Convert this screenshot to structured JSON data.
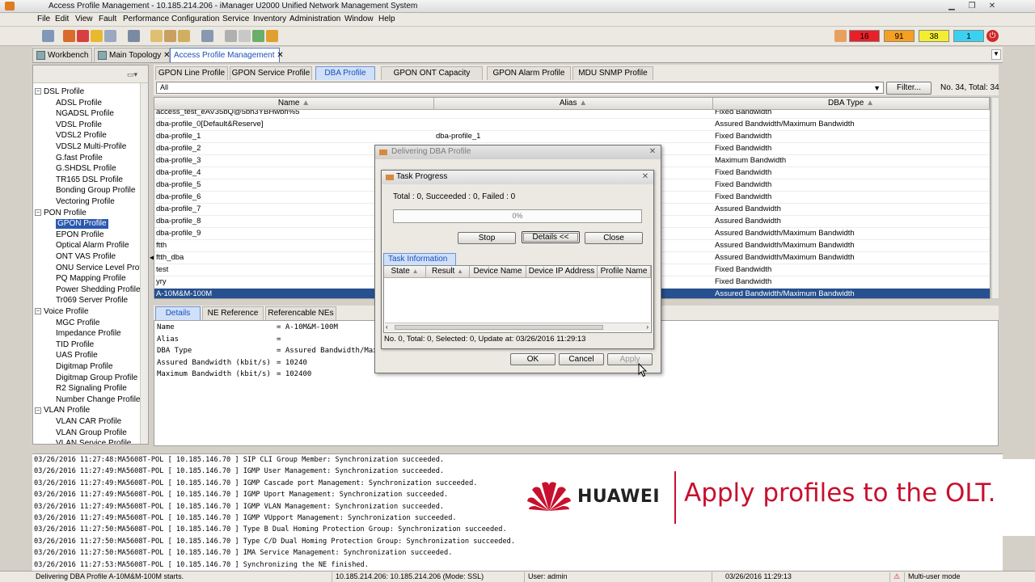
{
  "window": {
    "title": "Access Profile Management - 10.185.214.206 - iManager U2000 Unified Network Management System"
  },
  "menu": [
    "File",
    "Edit",
    "View",
    "Fault",
    "Performance",
    "Configuration",
    "Service",
    "Inventory",
    "Administration",
    "Window",
    "Help"
  ],
  "alarms": [
    {
      "count": "16",
      "color": "#e8202a"
    },
    {
      "count": "91",
      "color": "#f5a020"
    },
    {
      "count": "38",
      "color": "#f4ee30"
    },
    {
      "count": "1",
      "color": "#3ad2f0"
    }
  ],
  "window_tabs": [
    "Workbench",
    "Main Topology",
    "Access Profile Management"
  ],
  "tree": {
    "groups": [
      {
        "label": "DSL Profile",
        "children": [
          "ADSL Profile",
          "NGADSL Profile",
          "VDSL Profile",
          "VDSL2 Profile",
          "VDSL2 Multi-Profile",
          "G.fast Profile",
          "G.SHDSL Profile",
          "TR165 DSL Profile",
          "Bonding Group Profile",
          "Vectoring Profile"
        ]
      },
      {
        "label": "PON Profile",
        "children": [
          "GPON Profile",
          "EPON Profile",
          "Optical Alarm Profile",
          "ONT VAS Profile",
          "ONU Service Level Profile",
          "PQ Mapping Profile",
          "Power Shedding Profile",
          "Tr069 Server Profile"
        ]
      },
      {
        "label": "Voice Profile",
        "children": [
          "MGC Profile",
          "Impedance Profile",
          "TID Profile",
          "UAS Profile",
          "Digitmap Profile",
          "Digitmap Group Profile",
          "R2 Signaling Profile",
          "Number Change Profile"
        ]
      },
      {
        "label": "VLAN Profile",
        "children": [
          "VLAN CAR Profile",
          "VLAN Group Profile",
          "VLAN Service Profile"
        ]
      }
    ],
    "selected": "GPON Profile"
  },
  "profile_tabs": [
    "GPON Line Profile",
    "GPON Service Profile",
    "DBA Profile",
    "GPON ONT Capacity Profile",
    "GPON Alarm Profile",
    "MDU SNMP Profile"
  ],
  "filter": {
    "value": "All",
    "button": "Filter...",
    "count": "No. 34, Total: 34"
  },
  "grid": {
    "columns": [
      "Name",
      "Alias",
      "DBA Type"
    ],
    "rows": [
      {
        "name": "access_test_eAV35bQ@5bh3YBHwbh%5",
        "alias": "",
        "type": "Fixed Bandwidth"
      },
      {
        "name": "dba-profile_0[Default&Reserve]",
        "alias": "",
        "type": "Assured Bandwidth/Maximum Bandwidth"
      },
      {
        "name": "dba-profile_1",
        "alias": "dba-profile_1",
        "type": "Fixed Bandwidth"
      },
      {
        "name": "dba-profile_2",
        "alias": "",
        "type": "Fixed Bandwidth"
      },
      {
        "name": "dba-profile_3",
        "alias": "",
        "type": "Maximum Bandwidth"
      },
      {
        "name": "dba-profile_4",
        "alias": "",
        "type": "Fixed Bandwidth"
      },
      {
        "name": "dba-profile_5",
        "alias": "",
        "type": "Fixed Bandwidth"
      },
      {
        "name": "dba-profile_6",
        "alias": "",
        "type": "Fixed Bandwidth"
      },
      {
        "name": "dba-profile_7",
        "alias": "",
        "type": "Assured Bandwidth"
      },
      {
        "name": "dba-profile_8",
        "alias": "",
        "type": "Assured Bandwidth"
      },
      {
        "name": "dba-profile_9",
        "alias": "",
        "type": "Assured Bandwidth/Maximum Bandwidth"
      },
      {
        "name": "ftth",
        "alias": "",
        "type": "Assured Bandwidth/Maximum Bandwidth"
      },
      {
        "name": "ftth_dba",
        "alias": "",
        "type": "Assured Bandwidth/Maximum Bandwidth"
      },
      {
        "name": "test",
        "alias": "",
        "type": "Fixed Bandwidth"
      },
      {
        "name": "yry",
        "alias": "",
        "type": "Fixed Bandwidth"
      },
      {
        "name": "A-10M&M-100M",
        "alias": "",
        "type": "Assured Bandwidth/Maximum Bandwidth"
      }
    ],
    "selected_index": 15
  },
  "detail_tabs": [
    "Details",
    "NE Reference",
    "Referencable NEs"
  ],
  "details": [
    {
      "key": "Name",
      "value": "= A-10M&M-100M"
    },
    {
      "key": "Alias",
      "value": "="
    },
    {
      "key": "DBA Type",
      "value": "= Assured Bandwidth/Maximum Bandwidth"
    },
    {
      "key": "Assured Bandwidth (kbit/s)",
      "value": "= 10240"
    },
    {
      "key": "Maximum Bandwidth (kbit/s)",
      "value": "= 102400"
    }
  ],
  "log": [
    "03/26/2016 11:27:48:MA5608T-POL [ 10.185.146.70 ] SIP CLI Group Member: Synchronization succeeded.",
    "03/26/2016 11:27:49:MA5608T-POL [ 10.185.146.70 ] IGMP User Management: Synchronization succeeded.",
    "03/26/2016 11:27:49:MA5608T-POL [ 10.185.146.70 ] IGMP Cascade port Management: Synchronization succeeded.",
    "03/26/2016 11:27:49:MA5608T-POL [ 10.185.146.70 ] IGMP Uport Management: Synchronization succeeded.",
    "03/26/2016 11:27:49:MA5608T-POL [ 10.185.146.70 ] IGMP VLAN Management: Synchronization succeeded.",
    "03/26/2016 11:27:49:MA5608T-POL [ 10.185.146.70 ] IGMP VUpport Management: Synchronization succeeded.",
    "03/26/2016 11:27:50:MA5608T-POL [ 10.185.146.70 ] Type B Dual Homing Protection Group: Synchronization succeeded.",
    "03/26/2016 11:27:50:MA5608T-POL [ 10.185.146.70 ] Type C/D Dual Homing Protection Group: Synchronization succeeded.",
    "03/26/2016 11:27:50:MA5608T-POL [ 10.185.146.70 ] IMA Service Management: Synchronization succeeded.",
    "03/26/2016 11:27:53:MA5608T-POL [ 10.185.146.70 ] Synchronizing the NE finished."
  ],
  "status": {
    "message": "Delivering DBA Profile A-10M&M-100M starts.",
    "server": "10.185.214.206: 10.185.214.206 (Mode: SSL)",
    "user": "User: admin",
    "time": "03/26/2016 11:29:13",
    "mode": "Multi-user mode"
  },
  "outer_dialog": {
    "title": "Delivering DBA Profile",
    "ok": "OK",
    "cancel": "Cancel",
    "apply": "Apply"
  },
  "task_dialog": {
    "title": "Task Progress",
    "summary": "Total : 0, Succeeded : 0, Failed : 0",
    "progress_percent": 0,
    "progress_label": "0%",
    "buttons": {
      "stop": "Stop",
      "details": "Details <<",
      "close": "Close"
    },
    "info_tab": "Task Information",
    "columns": [
      "State",
      "Result",
      "Device Name",
      "Device IP Address",
      "Profile Name"
    ],
    "status_line": "No. 0, Total: 0, Selected: 0, Update at: 03/26/2016 11:29:13"
  },
  "banner": {
    "brand": "HUAWEI",
    "tagline": "Apply profiles to the OLT.",
    "brand_color": "#c8102e"
  }
}
